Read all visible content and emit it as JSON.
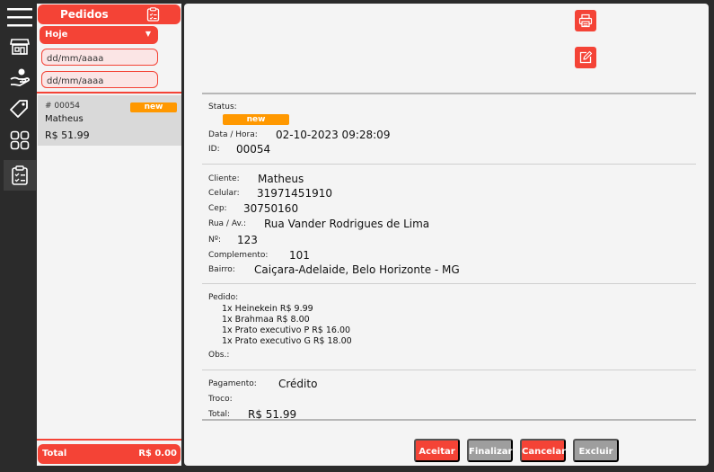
{
  "rail": {
    "icons": [
      "menu-icon",
      "store-icon",
      "hand-service-icon",
      "tag-icon",
      "grid-icon",
      "clipboard-icon"
    ]
  },
  "orders_panel": {
    "title": "Pedidos",
    "filter_selected": "Hoje",
    "date_placeholder": "dd/mm/aaaa",
    "orders": [
      {
        "number": "# 00054",
        "status": "new",
        "customer": "Matheus",
        "price": "R$ 51.99"
      }
    ],
    "footer_label": "Total",
    "footer_value": "R$ 0.00"
  },
  "detail": {
    "status_label": "Status:",
    "status_value": "new",
    "datetime_label": "Data / Hora:",
    "datetime_value": "02-10-2023 09:28:09",
    "id_label": "ID:",
    "id_value": "00054",
    "cliente_label": "Cliente:",
    "cliente_value": "Matheus",
    "celular_label": "Celular:",
    "celular_value": "31971451910",
    "cep_label": "Cep:",
    "cep_value": "30750160",
    "rua_label": "Rua / Av.:",
    "rua_value": "Rua Vander Rodrigues de Lima",
    "numero_label": "Nº:",
    "numero_value": "123",
    "complemento_label": "Complemento:",
    "complemento_value": "101",
    "bairro_label": "Bairro:",
    "bairro_value": "Caiçara-Adelaide, Belo Horizonte - MG",
    "pedido_label": "Pedido:",
    "items": [
      "1x Heinekein R$ 9.99",
      "1x Brahmaa R$ 8.00",
      "1x Prato executivo P R$ 16.00",
      "1x Prato executivo G R$ 18.00"
    ],
    "obs_label": "Obs.:",
    "pagamento_label": "Pagamento:",
    "pagamento_value": "Crédito",
    "troco_label": "Troco:",
    "total_label": "Total:",
    "total_value": "R$ 51.99"
  },
  "actions": {
    "aceitar": "Aceitar",
    "finalizar": "Finalizar",
    "cancelar": "Cancelar",
    "excluir": "Excluir"
  },
  "colors": {
    "accent": "#f44336",
    "badge": "#ff9800",
    "muted_button": "#9e9e9e",
    "rail": "#2b2b2b"
  }
}
